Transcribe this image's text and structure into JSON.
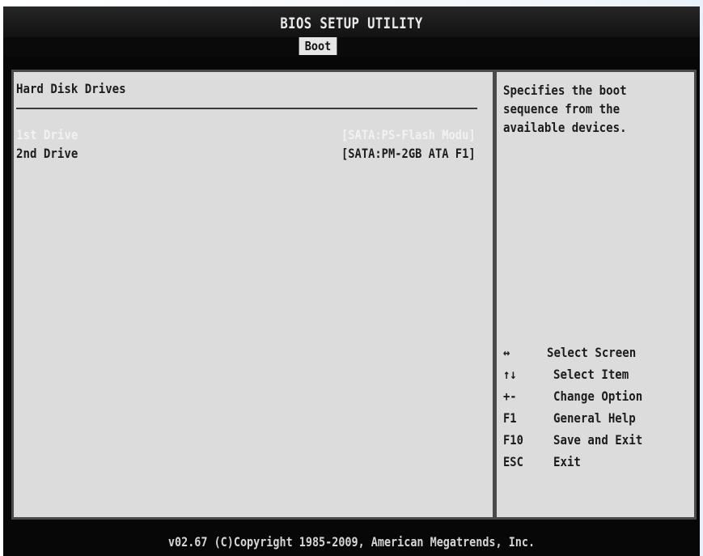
{
  "window": {
    "title": "BIOS SETUP UTILITY"
  },
  "tabs": [
    {
      "label": "Boot",
      "active": true
    }
  ],
  "main": {
    "section_title": "Hard Disk Drives",
    "items": [
      {
        "label": "1st Drive",
        "value": "[SATA:PS-Flash Modu]",
        "selected": true
      },
      {
        "label": "2nd Drive",
        "value": "[SATA:PM-2GB ATA F1]",
        "selected": false
      }
    ]
  },
  "help": {
    "lines": [
      "Specifies the boot",
      "sequence from the",
      "available devices."
    ],
    "keys": [
      {
        "icon": "left-right-arrow-icon",
        "key": "↔",
        "desc": "Select Screen"
      },
      {
        "icon": "up-down-arrow-icon",
        "key": "↑↓",
        "desc": "Select Item"
      },
      {
        "key": "+-",
        "desc": "Change Option"
      },
      {
        "key": "F1",
        "desc": "General Help"
      },
      {
        "key": "F10",
        "desc": "Save and Exit"
      },
      {
        "key": "ESC",
        "desc": "Exit"
      }
    ]
  },
  "footer": {
    "text": "v02.67 (C)Copyright 1985-2009, American Megatrends, Inc."
  },
  "colors": {
    "background": "#070707",
    "panel": "#dcdcdc",
    "selected_text": "#f2f2f2",
    "text": "#1c1c1c"
  }
}
